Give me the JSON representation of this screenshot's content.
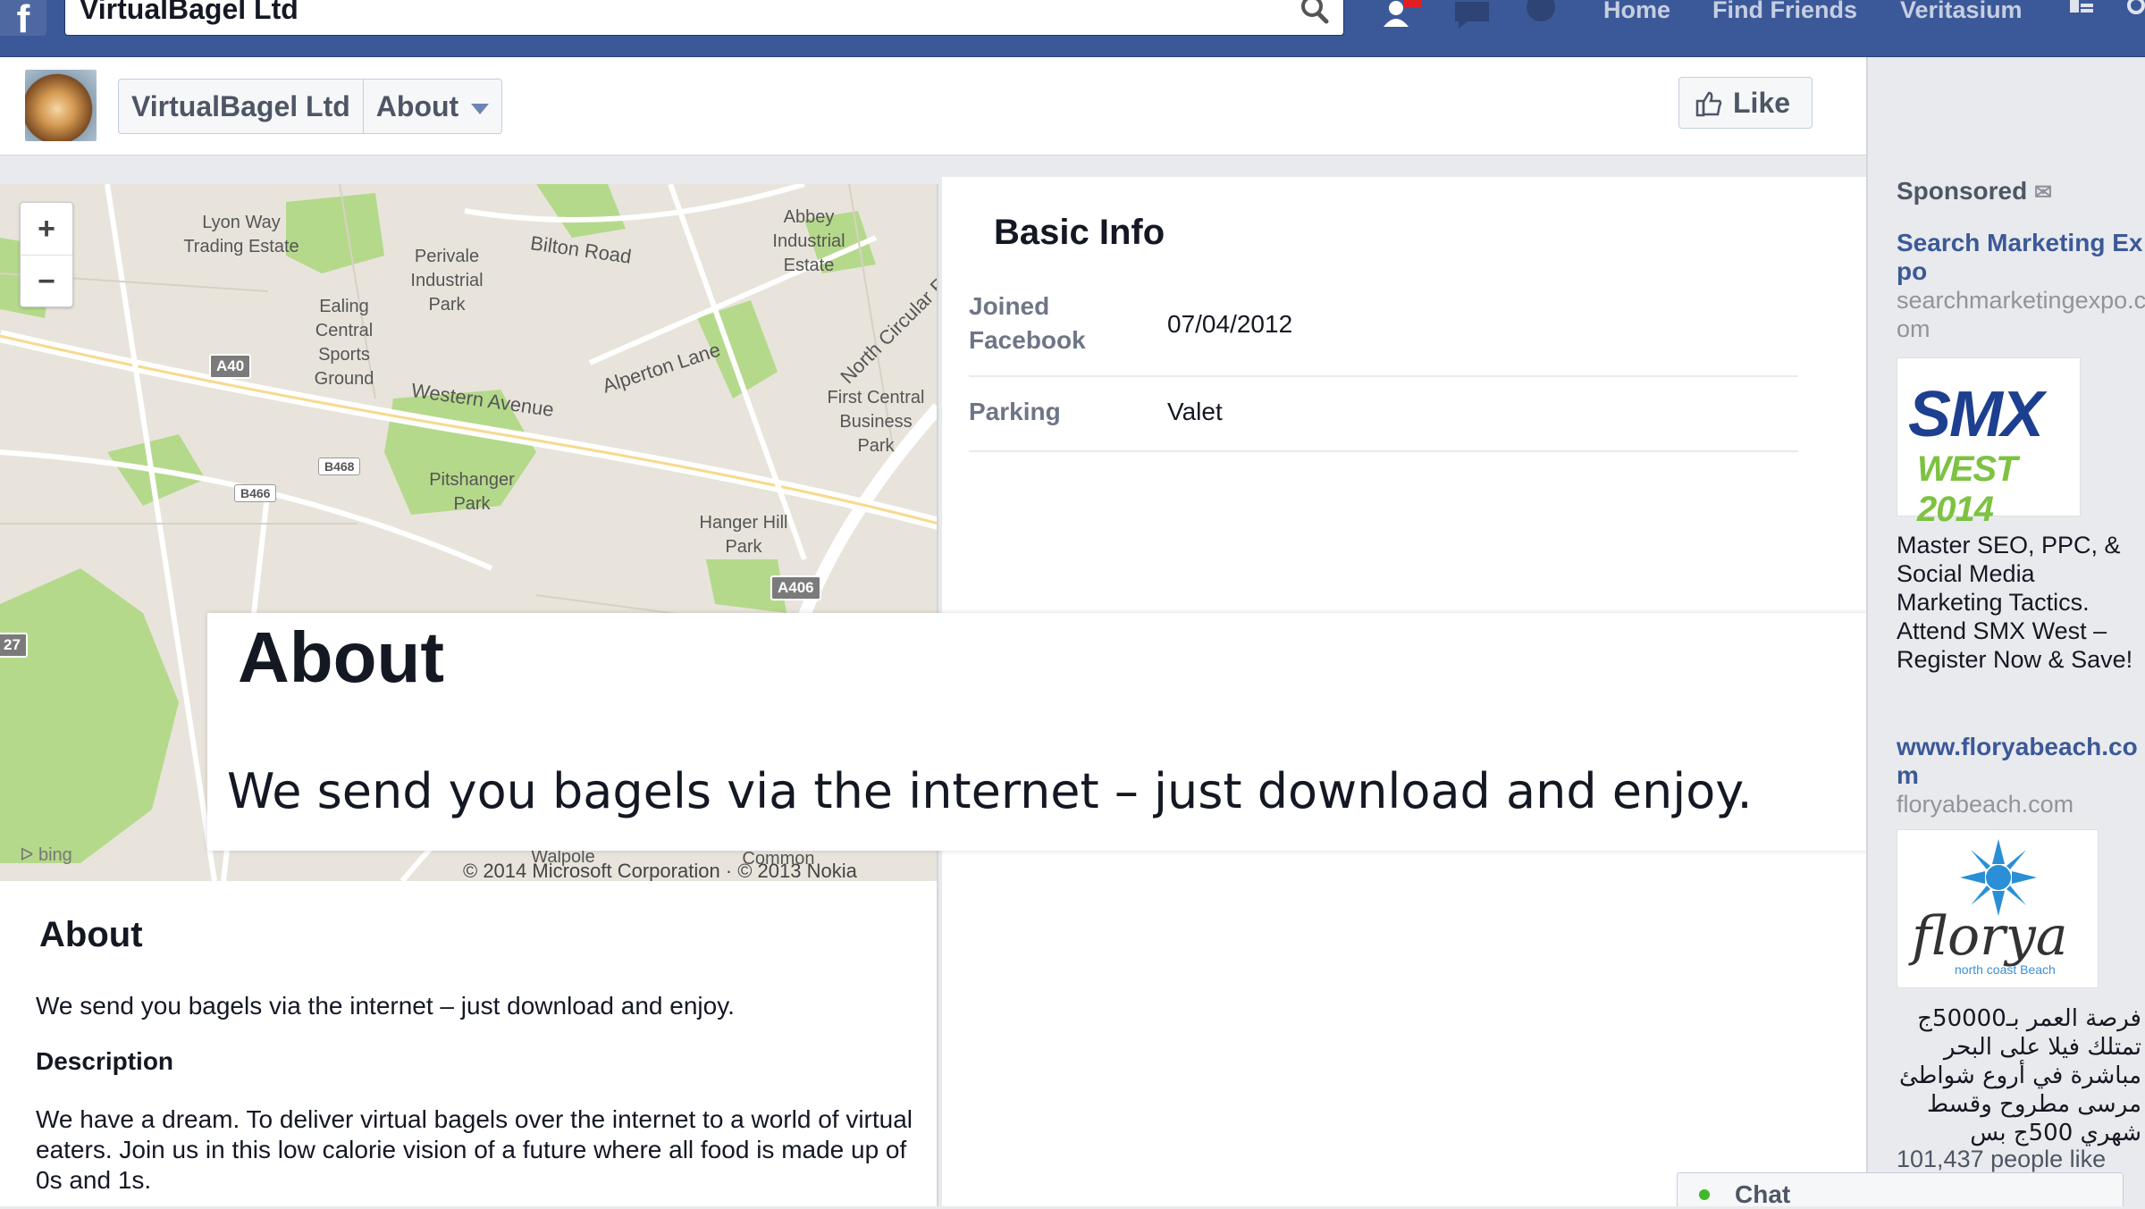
{
  "topbar": {
    "logo": "f",
    "search_value": "VirtualBagel Ltd",
    "nav": [
      "Home",
      "Find Friends",
      "Veritasium"
    ]
  },
  "page_header": {
    "page_name": "VirtualBagel Ltd",
    "section": "About",
    "like_label": "Like"
  },
  "map": {
    "labels": [
      "Lyon Way Trading Estate",
      "Perivale Industrial Park",
      "Bilton Road",
      "Abbey Industrial Estate",
      "Ealing Central Sports Ground",
      "Alperton Lane",
      "North Circular R",
      "Western Avenue",
      "First Central Business Park",
      "Pitshanger Park",
      "Hanger Hill Park",
      "Walpole",
      "Common"
    ],
    "shields": [
      "A40",
      "B468",
      "B466",
      "A406",
      "27"
    ],
    "zoom_in": "+",
    "zoom_out": "−",
    "provider": "bing",
    "copyright": "© 2014 Microsoft Corporation · © 2013 Nokia"
  },
  "basic_info": {
    "title": "Basic Info",
    "rows": [
      {
        "key": "Joined Facebook",
        "value": "07/04/2012"
      },
      {
        "key": "Parking",
        "value": "Valet"
      }
    ]
  },
  "about": {
    "title": "About",
    "text": "We send you bagels via the internet – just download and enjoy.",
    "description_heading": "Description",
    "description": "We have a dream. To deliver virtual bagels over the internet to a world of virtual eaters. Join us in this low calorie vision of a future where all food is made up of 0s and 1s."
  },
  "overlay": {
    "title": "About",
    "text": "We send you bagels via the internet – just download and enjoy."
  },
  "sponsored": {
    "heading": "Sponsored",
    "ads": [
      {
        "title": "Search Marketing Expo",
        "domain": "searchmarketingexpo.com",
        "image_text_1": "SMX",
        "image_text_2": "WEST 2014",
        "body": "Master SEO, PPC, & Social Media Marketing Tactics. Attend SMX West – Register Now & Save!"
      },
      {
        "title": "www.floryabeach.com",
        "domain": "floryabeach.com",
        "image_text_1": "florya",
        "image_text_2": "north coast  Beach",
        "body": "فرصة العمر بـ50000ج تمتلك فيلا على البحر مباشرة في أروع شواطئ مرسى مطروح وقسط شهري 500ج بس"
      }
    ],
    "likes": "101,437 people like"
  },
  "chat": {
    "label": "Chat"
  },
  "colors": {
    "brand": "#3b5998",
    "link": "#3b5998",
    "map_park": "#b5d98b",
    "map_bg": "#e8e4dc"
  }
}
